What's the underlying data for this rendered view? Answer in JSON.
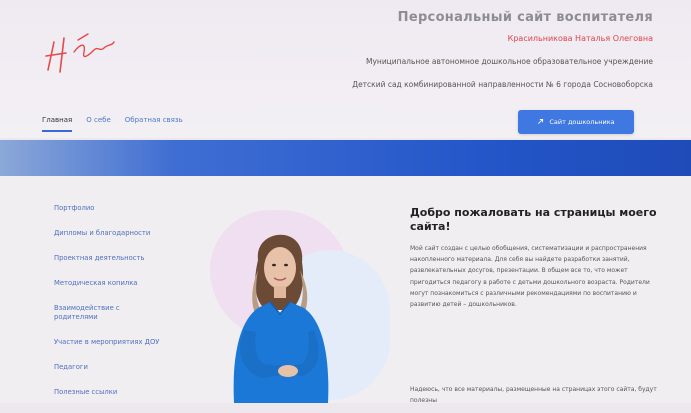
{
  "header": {
    "site_title": "Персональный сайт воспитателя",
    "owner_name": "Красильникова Наталья Олеговна",
    "institution_line1": "Муниципальное автономное дошкольное образовательное учреждение",
    "institution_line2": "Детский сад комбинированной направленности № 6 города Сосновоборска"
  },
  "nav": {
    "items": [
      {
        "label": "Главная"
      },
      {
        "label": "О себе"
      },
      {
        "label": "Обратная связь"
      }
    ],
    "cta_label": "Сайт дошкольника"
  },
  "sidebar": {
    "items": [
      {
        "label": "Портфолио"
      },
      {
        "label": "Дипломы и благодарности"
      },
      {
        "label": "Проектная деятельность"
      },
      {
        "label": "Методическая копилка"
      },
      {
        "label": "Взаимодействие с родителями"
      },
      {
        "label": "Участие в мероприятиях ДОУ"
      },
      {
        "label": "Педагоги"
      },
      {
        "label": "Полезные ссылки"
      }
    ]
  },
  "content": {
    "welcome_title": "Добро пожаловать на страницы моего сайта!",
    "paragraph1": "Мой сайт создан с целью обобщения, систематизации и распространения накопленного материала. Для себя вы найдете разработки занятий, развлекательных досугов, презентации. В общем все то, что может пригодиться педагогу в работе с детьми дошкольного возраста. Родители могут познакомиться с различными рекомендациями по воспитанию и развитию детей – дошкольников.",
    "paragraph2": "Надеюсь, что все материалы, размещенные на страницах этого сайта, будут полезны"
  },
  "colors": {
    "accent": "#3f78e0",
    "owner_red": "#e0434f",
    "nav_link": "#4d78c8"
  }
}
